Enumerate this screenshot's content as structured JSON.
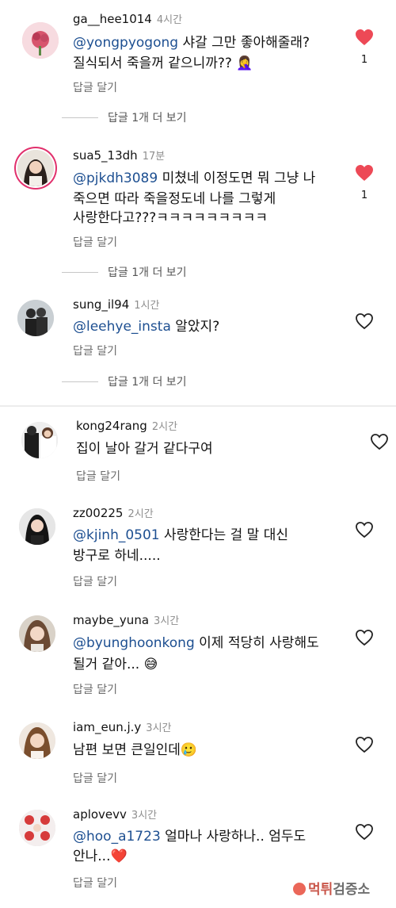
{
  "comments": [
    {
      "username": "ga__hee1014",
      "time": "4시간",
      "mention": "@yongpyogong",
      "line1": " 샤갈 그만 좋아해줄래?",
      "line2": "질식되서 죽을꺼 같으니까?? 🤦‍♀️",
      "reply": "답글 달기",
      "liked": true,
      "like_count": "1"
    },
    {
      "username": "sua5_13dh",
      "time": "17분",
      "mention": "@pjkdh3089",
      "line1": " 미쳤네 이정도면 뭐 그냥 나",
      "line2": "죽으면 따라 죽을정도네 나를 그렇게",
      "line3": "사랑한다고???ㅋㅋㅋㅋㅋㅋㅋㅋㅋ",
      "reply": "답글 달기",
      "liked": true,
      "like_count": "1"
    },
    {
      "username": "sung_il94",
      "time": "1시간",
      "mention": "@leehye_insta",
      "line1": " 알았지?",
      "reply": "답글 달기",
      "liked": false
    },
    {
      "username": "kong24rang",
      "time": "2시간",
      "line1": "집이 날아 갈거 같다구여",
      "reply": "답글 달기",
      "liked": false
    },
    {
      "username": "zz00225",
      "time": "2시간",
      "mention": "@kjinh_0501",
      "line1": "  사랑한다는 걸 말 대신",
      "line2": "방구로 하네.....",
      "reply": "답글 달기",
      "liked": false
    },
    {
      "username": "maybe_yuna",
      "time": "3시간",
      "mention": "@byunghoonkong",
      "line1": " 이제 적당히 사랑해도",
      "line2": "될거 같아... 😅",
      "reply": "답글 달기",
      "liked": false
    },
    {
      "username": "iam_eun.j.y",
      "time": "3시간",
      "line1": "남편 보면 큰일인데🥲",
      "reply": "답글 달기",
      "liked": false
    },
    {
      "username": "aplovevv",
      "time": "3시간",
      "mention": "@hoo_a1723",
      "line1": " 얼마나 사랑하나.. 엄두도",
      "line2": "안나...❤️",
      "reply": "답글 달기",
      "liked": false
    }
  ],
  "view_more": [
    "답글 1개 더 보기",
    "답글 1개 더 보기",
    "답글 1개 더 보기"
  ],
  "watermark": {
    "brand": "먹튀",
    "suffix": "검증소"
  },
  "colors": {
    "like_red": "#ed4956",
    "mention_blue": "#1d4f91",
    "story_ring": "#e1306c",
    "watermark_red": "#c0392b"
  }
}
